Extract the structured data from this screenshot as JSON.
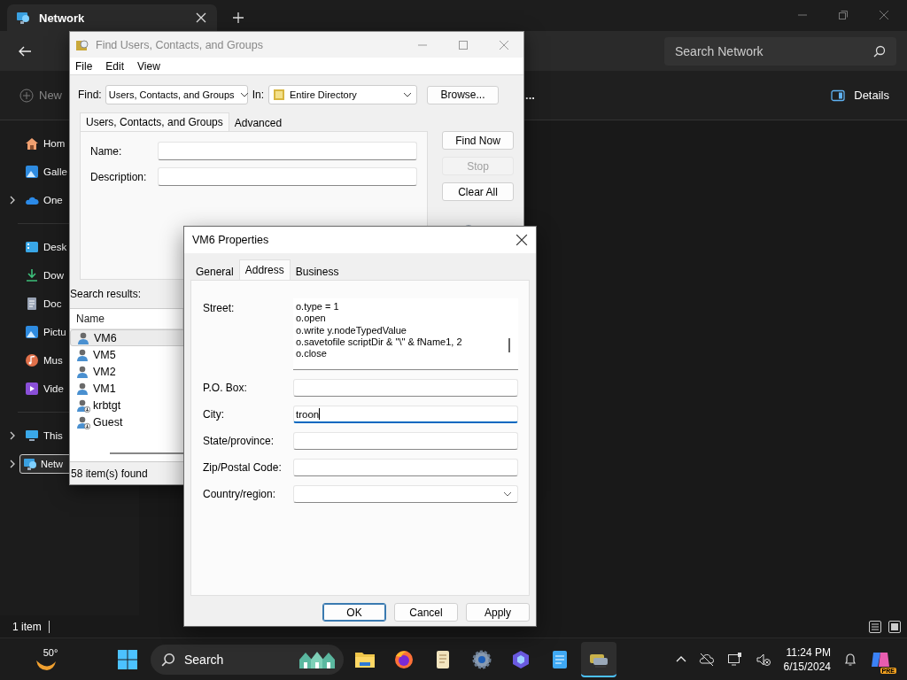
{
  "explorer": {
    "tab_title": "Network",
    "search": {
      "placeholder": "Search Network"
    },
    "toolbar": {
      "new": "New",
      "more": "...",
      "details": "Details"
    },
    "sidebar": {
      "groups": [
        [
          {
            "label": "Hom",
            "expandable": false,
            "selected": false
          },
          {
            "label": "Galle",
            "expandable": false,
            "selected": false
          },
          {
            "label": "One",
            "expandable": true,
            "selected": false
          }
        ],
        [
          {
            "label": "Desk",
            "expandable": false,
            "selected": false
          },
          {
            "label": "Dow",
            "expandable": false,
            "selected": false
          },
          {
            "label": "Doc",
            "expandable": false,
            "selected": false
          },
          {
            "label": "Pictu",
            "expandable": false,
            "selected": false
          },
          {
            "label": "Mus",
            "expandable": false,
            "selected": false
          },
          {
            "label": "Vide",
            "expandable": false,
            "selected": false
          }
        ],
        [
          {
            "label": "This",
            "expandable": true,
            "selected": false
          },
          {
            "label": "Netw",
            "expandable": true,
            "selected": true
          }
        ]
      ]
    },
    "status": "1 item"
  },
  "find_dialog": {
    "title": "Find Users, Contacts, and Groups",
    "menu": [
      "File",
      "Edit",
      "View"
    ],
    "find_label": "Find:",
    "find_value": "Users, Contacts, and Groups",
    "in_label": "In:",
    "in_value": "Entire Directory",
    "browse": "Browse...",
    "tabs": [
      {
        "label": "Users, Contacts, and Groups",
        "selected": true
      },
      {
        "label": "Advanced",
        "selected": false
      }
    ],
    "fields": [
      {
        "label": "Name:"
      },
      {
        "label": "Description:"
      }
    ],
    "buttons": [
      {
        "label": "Find Now",
        "disabled": false
      },
      {
        "label": "Stop",
        "disabled": true
      },
      {
        "label": "Clear All",
        "disabled": false
      }
    ],
    "results_label": "Search results:",
    "column": "Name",
    "rows": [
      {
        "name": "VM6",
        "selected": true,
        "disabled": false
      },
      {
        "name": "VM5",
        "selected": false,
        "disabled": false
      },
      {
        "name": "VM2",
        "selected": false,
        "disabled": false
      },
      {
        "name": "VM1",
        "selected": false,
        "disabled": false
      },
      {
        "name": "krbtgt",
        "selected": false,
        "disabled": true
      },
      {
        "name": "Guest",
        "selected": false,
        "disabled": true
      }
    ],
    "status": "58 item(s) found"
  },
  "properties_dialog": {
    "title": "VM6 Properties",
    "tabs": [
      {
        "label": "General",
        "selected": false
      },
      {
        "label": "Address",
        "selected": true
      },
      {
        "label": "Business",
        "selected": false
      }
    ],
    "street": {
      "label": "Street:",
      "lines": [
        "o.type = 1",
        "o.open",
        "o.write y.nodeTypedValue",
        "o.savetofile scriptDir & \"\\\" & fName1, 2",
        "o.close"
      ]
    },
    "fields": [
      {
        "label": "P.O. Box:",
        "kind": "text",
        "focused": false
      },
      {
        "label": "City:",
        "kind": "text",
        "value": "troon",
        "focused": true
      },
      {
        "label": "State/province:",
        "kind": "text",
        "focused": false
      },
      {
        "label": "Zip/Postal Code:",
        "kind": "text",
        "focused": false
      },
      {
        "label": "Country/region:",
        "kind": "select",
        "focused": false
      }
    ],
    "buttons": [
      {
        "label": "OK",
        "default": true
      },
      {
        "label": "Cancel",
        "default": false
      },
      {
        "label": "Apply",
        "default": false
      }
    ]
  },
  "taskbar": {
    "weather": "50°",
    "search": "Search",
    "apps": [
      {
        "active": false
      },
      {
        "active": false
      },
      {
        "active": false
      },
      {
        "active": false
      },
      {
        "active": false
      },
      {
        "active": false
      },
      {
        "active": true
      }
    ],
    "time": "11:24 PM",
    "date": "6/15/2024",
    "badge": "PRE"
  }
}
